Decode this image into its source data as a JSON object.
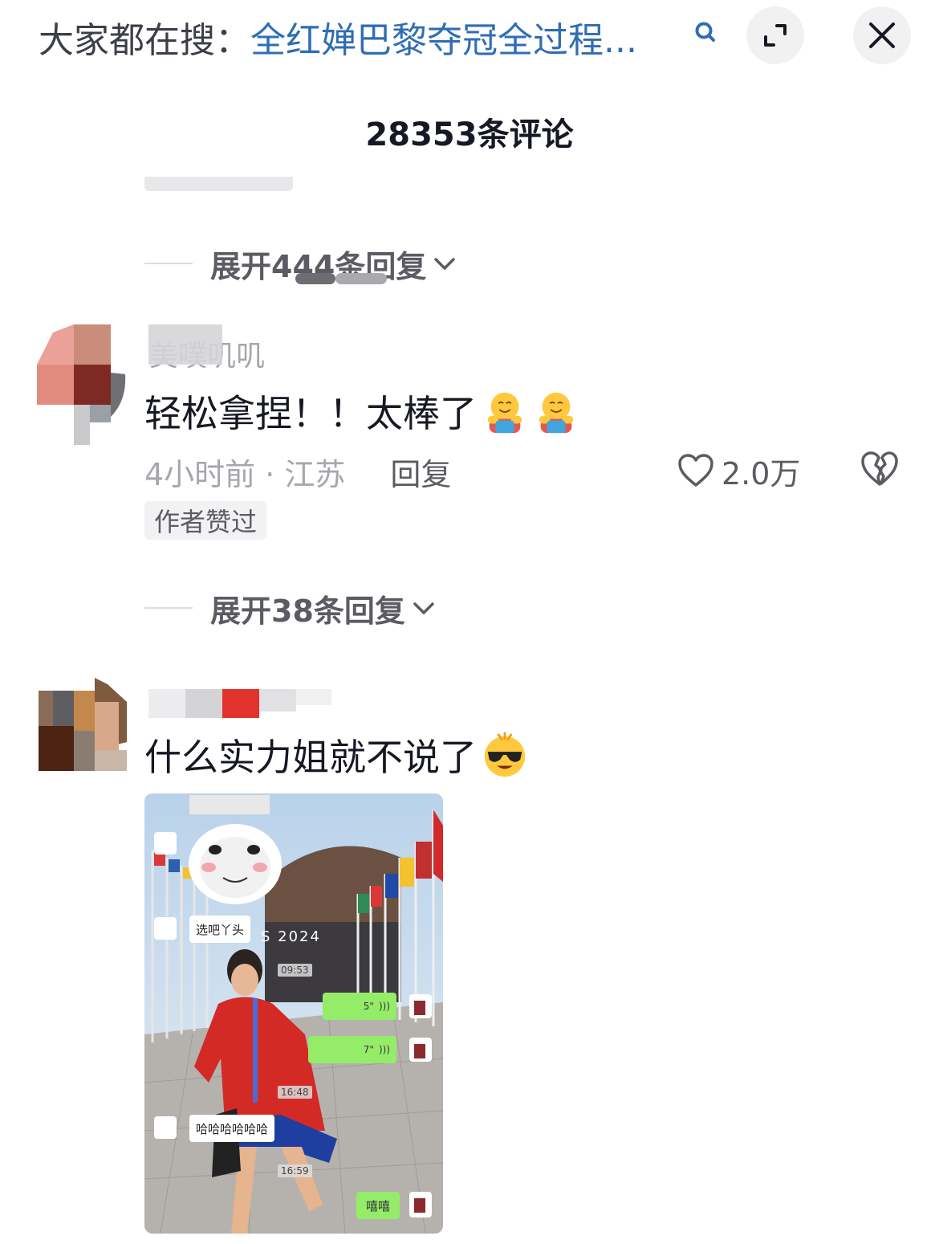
{
  "search_bar": {
    "prefix": "大家都在搜：",
    "query": "全红婵巴黎夺冠全过程...",
    "search_icon": "search-icon",
    "expand_icon": "expand-icon",
    "close_icon": "close-icon"
  },
  "header": {
    "comment_count": "28353条评论"
  },
  "replies_1": {
    "label": "展开444条回复"
  },
  "comment_1": {
    "username": "美噗叽叽",
    "text": "轻松拿捏！！太棒了",
    "emoji": "hug-emoji",
    "time_location": "4小时前 · 江苏",
    "reply": "回复",
    "likes": "2.0万",
    "author_liked": "作者赞过",
    "expand_replies": "展开38条回复"
  },
  "comment_2": {
    "username": "",
    "text": "什么实力姐就不说了",
    "emoji": "cool-sunglasses-emoji",
    "image": {
      "bubble_1": "选吧丫头",
      "bubble_2": "哈哈哈哈哈哈",
      "bubble_3": "嘻嘻",
      "voice_1": "5\"",
      "voice_2": "7\"",
      "time_1": "09:53",
      "time_2": "16:48",
      "time_3": "16:59",
      "sign_text": "S 2024"
    }
  },
  "colors": {
    "link_blue": "#2f6db3",
    "muted_gray": "#a6a7ad",
    "chat_green": "#95ec69"
  }
}
